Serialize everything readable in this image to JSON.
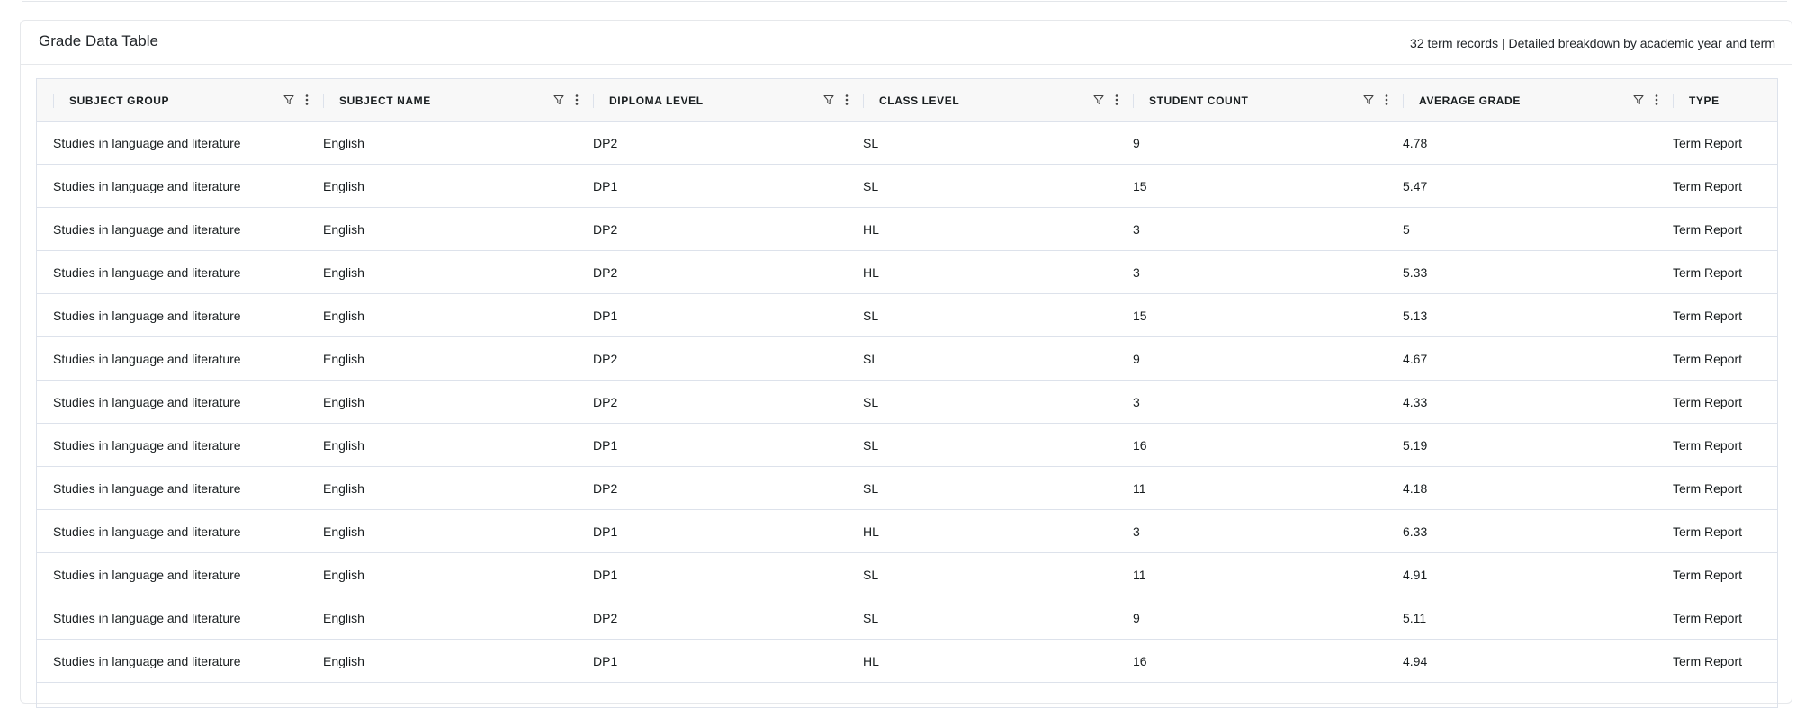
{
  "card": {
    "title": "Grade Data Table",
    "subtitle": "32 term records | Detailed breakdown by academic year and term"
  },
  "table": {
    "columns": [
      {
        "key": "subject_group",
        "label": "SUBJECT GROUP",
        "filter_icon": "filter-icon",
        "menu_icon": "vertical-ellipsis-icon"
      },
      {
        "key": "subject_name",
        "label": "SUBJECT NAME",
        "filter_icon": "filter-icon",
        "menu_icon": "vertical-ellipsis-icon"
      },
      {
        "key": "diploma_level",
        "label": "DIPLOMA LEVEL",
        "filter_icon": "filter-icon",
        "menu_icon": "vertical-ellipsis-icon"
      },
      {
        "key": "class_level",
        "label": "CLASS LEVEL",
        "filter_icon": "filter-icon",
        "menu_icon": "vertical-ellipsis-icon"
      },
      {
        "key": "student_count",
        "label": "STUDENT COUNT",
        "filter_icon": "filter-icon",
        "menu_icon": "vertical-ellipsis-icon"
      },
      {
        "key": "average_grade",
        "label": "AVERAGE GRADE",
        "filter_icon": "filter-icon",
        "menu_icon": "vertical-ellipsis-icon"
      },
      {
        "key": "type",
        "label": "TYPE"
      }
    ],
    "rows": [
      {
        "subject_group": "Studies in language and literature",
        "subject_name": "English",
        "diploma_level": "DP2",
        "class_level": "SL",
        "student_count": "9",
        "average_grade": "4.78",
        "type": "Term Report"
      },
      {
        "subject_group": "Studies in language and literature",
        "subject_name": "English",
        "diploma_level": "DP1",
        "class_level": "SL",
        "student_count": "15",
        "average_grade": "5.47",
        "type": "Term Report"
      },
      {
        "subject_group": "Studies in language and literature",
        "subject_name": "English",
        "diploma_level": "DP2",
        "class_level": "HL",
        "student_count": "3",
        "average_grade": "5",
        "type": "Term Report"
      },
      {
        "subject_group": "Studies in language and literature",
        "subject_name": "English",
        "diploma_level": "DP2",
        "class_level": "HL",
        "student_count": "3",
        "average_grade": "5.33",
        "type": "Term Report"
      },
      {
        "subject_group": "Studies in language and literature",
        "subject_name": "English",
        "diploma_level": "DP1",
        "class_level": "SL",
        "student_count": "15",
        "average_grade": "5.13",
        "type": "Term Report"
      },
      {
        "subject_group": "Studies in language and literature",
        "subject_name": "English",
        "diploma_level": "DP2",
        "class_level": "SL",
        "student_count": "9",
        "average_grade": "4.67",
        "type": "Term Report"
      },
      {
        "subject_group": "Studies in language and literature",
        "subject_name": "English",
        "diploma_level": "DP2",
        "class_level": "SL",
        "student_count": "3",
        "average_grade": "4.33",
        "type": "Term Report"
      },
      {
        "subject_group": "Studies in language and literature",
        "subject_name": "English",
        "diploma_level": "DP1",
        "class_level": "SL",
        "student_count": "16",
        "average_grade": "5.19",
        "type": "Term Report"
      },
      {
        "subject_group": "Studies in language and literature",
        "subject_name": "English",
        "diploma_level": "DP2",
        "class_level": "SL",
        "student_count": "11",
        "average_grade": "4.18",
        "type": "Term Report"
      },
      {
        "subject_group": "Studies in language and literature",
        "subject_name": "English",
        "diploma_level": "DP1",
        "class_level": "HL",
        "student_count": "3",
        "average_grade": "6.33",
        "type": "Term Report"
      },
      {
        "subject_group": "Studies in language and literature",
        "subject_name": "English",
        "diploma_level": "DP1",
        "class_level": "SL",
        "student_count": "11",
        "average_grade": "4.91",
        "type": "Term Report"
      },
      {
        "subject_group": "Studies in language and literature",
        "subject_name": "English",
        "diploma_level": "DP2",
        "class_level": "SL",
        "student_count": "9",
        "average_grade": "5.11",
        "type": "Term Report"
      },
      {
        "subject_group": "Studies in language and literature",
        "subject_name": "English",
        "diploma_level": "DP1",
        "class_level": "HL",
        "student_count": "16",
        "average_grade": "4.94",
        "type": "Term Report"
      }
    ]
  }
}
